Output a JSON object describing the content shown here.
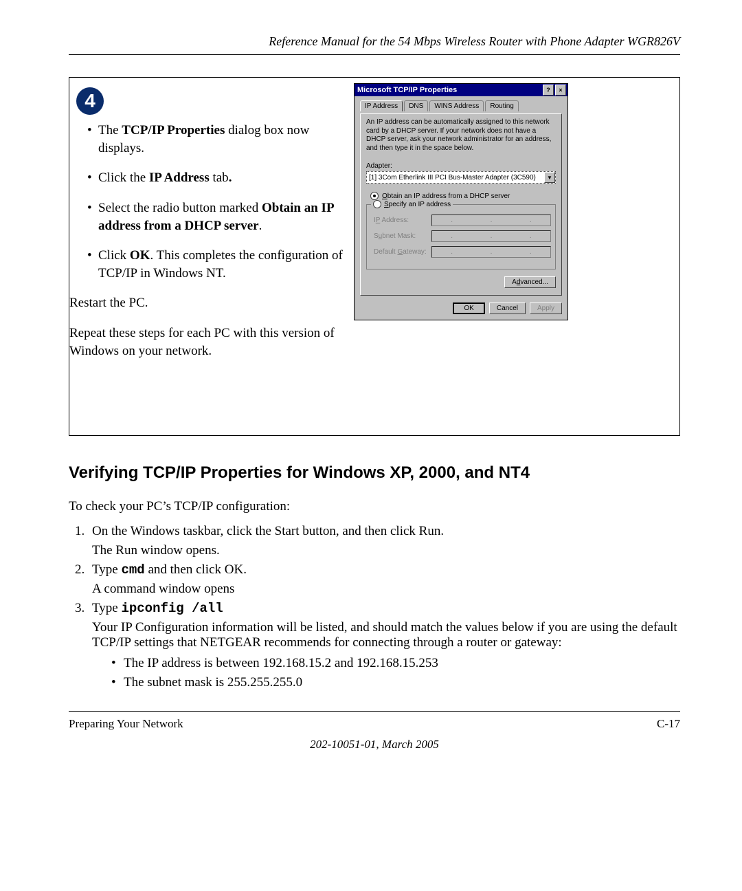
{
  "header": {
    "title": "Reference Manual for the 54 Mbps Wireless Router with Phone Adapter WGR826V"
  },
  "step": {
    "number": "4"
  },
  "instructions": {
    "b1_pre": "The ",
    "b1_bold": "TCP/IP Properties",
    "b1_post": " dialog box now displays.",
    "b2_pre": "Click the ",
    "b2_bold": "IP Address",
    "b2_post": " tab",
    "b3_pre": "Select the radio button marked ",
    "b3_bold": "Obtain an IP address from a DHCP server",
    "b4_pre": "Click ",
    "b4_bold": "OK",
    "b4_post": ".  This completes the configuration of TCP/IP in Windows NT.",
    "restart": "Restart the PC.",
    "repeat": "Repeat these steps for each PC with this version of Windows on your network."
  },
  "dialog": {
    "title": "Microsoft TCP/IP Properties",
    "help_btn": "?",
    "close_btn": "×",
    "tabs": [
      "IP Address",
      "DNS",
      "WINS Address",
      "Routing"
    ],
    "desc": "An IP address can be automatically assigned to this network card by a DHCP server. If your network does not have a DHCP server, ask your network administrator for an address, and then type it in the space below.",
    "adapter_label": "Adapter:",
    "adapter_value": "[1] 3Com Etherlink III PCI Bus-Master Adapter (3C590)",
    "radio_obtain_u": "O",
    "radio_obtain_rest": "btain an IP address from a DHCP server",
    "radio_specify_u": "S",
    "radio_specify_rest": "pecify an IP address",
    "ip_label_u": "P",
    "ip_label_pre": "I",
    "ip_label_post": " Address:",
    "subnet_label_pre": "S",
    "subnet_label_u": "u",
    "subnet_label_post": "bnet Mask:",
    "gw_label_pre": "Default ",
    "gw_label_u": "G",
    "gw_label_post": "ateway:",
    "advanced_u": "d",
    "advanced_pre": "A",
    "advanced_post": "vanced...",
    "ok": "OK",
    "cancel": "Cancel",
    "apply": "Apply"
  },
  "body": {
    "heading": "Verifying TCP/IP Properties for Windows XP, 2000, and NT4",
    "intro": "To check your PC’s TCP/IP configuration:",
    "s1_line1": "On the Windows taskbar, click the Start button, and then click Run.",
    "s1_line2": "The Run window opens.",
    "s2_pre": "Type ",
    "s2_cmd": "cmd",
    "s2_post": " and then click OK.",
    "s2_line2": "A command window opens",
    "s3_pre": "Type ",
    "s3_cmd": "ipconfig /all",
    "s3_para": "Your IP Configuration information will be listed, and should match the values below if you are using the default TCP/IP settings that NETGEAR recommends for connecting through a router or gateway:",
    "s3_b1": "The IP address is between 192.168.15.2 and 192.168.15.253",
    "s3_b2": "The subnet mask is 255.255.255.0"
  },
  "footer": {
    "left": "Preparing Your Network",
    "right": "C-17",
    "docnum": "202-10051-01, March 2005"
  }
}
